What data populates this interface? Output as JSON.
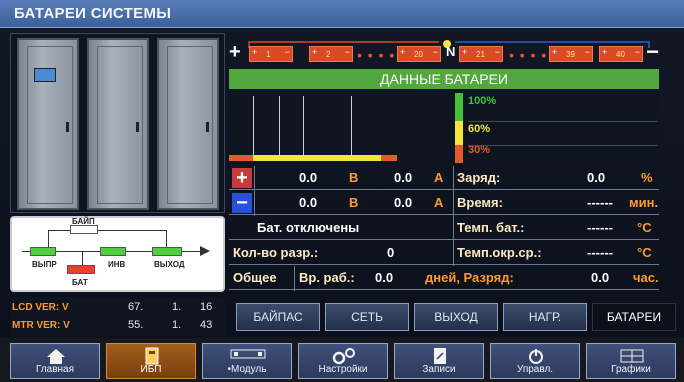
{
  "window": {
    "title": "БАТАРЕИ СИСТЕМЫ"
  },
  "battery_string": {
    "plus_symbol": "+",
    "minus_symbol": "−",
    "neutral_label": "N",
    "dots": "• • • •",
    "cells": [
      "1",
      "2",
      "20",
      "21",
      "39",
      "40"
    ],
    "cell_color": "#d94a28",
    "left_link_color": "#d94a28",
    "right_link_color": "#2f5bd8"
  },
  "data_header": "ДАННЫЕ БАТАРЕИ",
  "level_legend": [
    "100%",
    "60%",
    "30%"
  ],
  "level_colors": {
    "high": "#43c13c",
    "mid": "#f0e73a",
    "low": "#e8582b"
  },
  "readings": {
    "plus_sign": "+",
    "minus_sign": "−",
    "pos_voltage": "0.0",
    "pos_voltage_unit": "В",
    "pos_current": "0.0",
    "pos_current_unit": "А",
    "neg_voltage": "0.0",
    "neg_voltage_unit": "В",
    "neg_current": "0.0",
    "neg_current_unit": "А",
    "status": "Бат. отключены",
    "discharge_count_label": "Кол-во разр.:",
    "discharge_count": "0",
    "total_label": "Общее",
    "runtime_label": "Вр. раб.:",
    "runtime_value": "0.0",
    "runtime_suffix": "дней, Разряд:",
    "discharge_time": "0.0",
    "discharge_time_unit": "час.",
    "charge_label": "Заряд:",
    "charge_value": "0.0",
    "charge_unit": "%",
    "time_label": "Время:",
    "time_value": "------",
    "time_unit": "мин.",
    "bat_temp_label": "Темп. бат.:",
    "bat_temp_value": "------",
    "bat_temp_unit": "°C",
    "env_temp_label": "Темп.окр.ср.:",
    "env_temp_value": "------",
    "env_temp_unit": "°C"
  },
  "flow": {
    "bypass": "БАЙП",
    "rect": "ВЫПР",
    "inv": "ИНВ",
    "out": "ВЫХОД",
    "bat": "БАТ"
  },
  "version": {
    "lcd_label": "LCD VER: V",
    "lcd_a": "67.",
    "lcd_b": "1.",
    "lcd_c": "16",
    "mtr_label": "MTR VER: V",
    "mtr_a": "55.",
    "mtr_b": "1.",
    "mtr_c": "43"
  },
  "tabs": [
    "БАЙПАС",
    "СЕТЬ",
    "ВЫХОД",
    "НАГР.",
    "БАТАРЕИ"
  ],
  "active_tab": "БАТАРЕИ",
  "nav": [
    {
      "label": "Главная",
      "icon": "home-icon"
    },
    {
      "label": "ИБП",
      "icon": "ups-icon"
    },
    {
      "label": "•Модуль",
      "icon": "module-icon"
    },
    {
      "label": "Настройки",
      "icon": "gears-icon"
    },
    {
      "label": "Записи",
      "icon": "records-icon"
    },
    {
      "label": "Управл.",
      "icon": "power-icon"
    },
    {
      "label": "Графики",
      "icon": "charts-icon"
    }
  ],
  "active_nav": "ИБП"
}
